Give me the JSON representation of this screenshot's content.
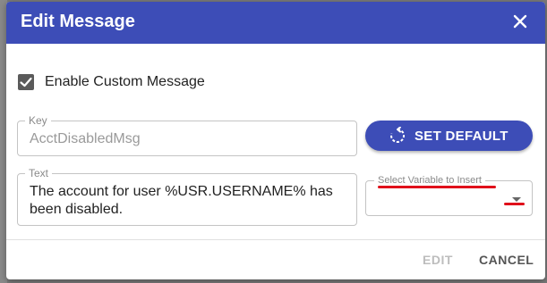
{
  "dialog": {
    "title": "Edit Message",
    "close_icon": "close-icon",
    "enable_custom": {
      "label": "Enable Custom Message",
      "checked": true
    },
    "key_field": {
      "label": "Key",
      "value": "AcctDisabledMsg"
    },
    "set_default": {
      "label": "SET DEFAULT",
      "icon": "reset-icon"
    },
    "text_field": {
      "label": "Text",
      "value": "The account for user %USR.USERNAME% has been disabled."
    },
    "variable_select": {
      "label": "Select Variable to Insert",
      "value": "",
      "icon": "chevron-down-icon"
    },
    "footer": {
      "edit_label": "EDIT",
      "cancel_label": "CANCEL"
    }
  },
  "colors": {
    "header": "#3d4db7",
    "annotation": "#e0101a"
  }
}
